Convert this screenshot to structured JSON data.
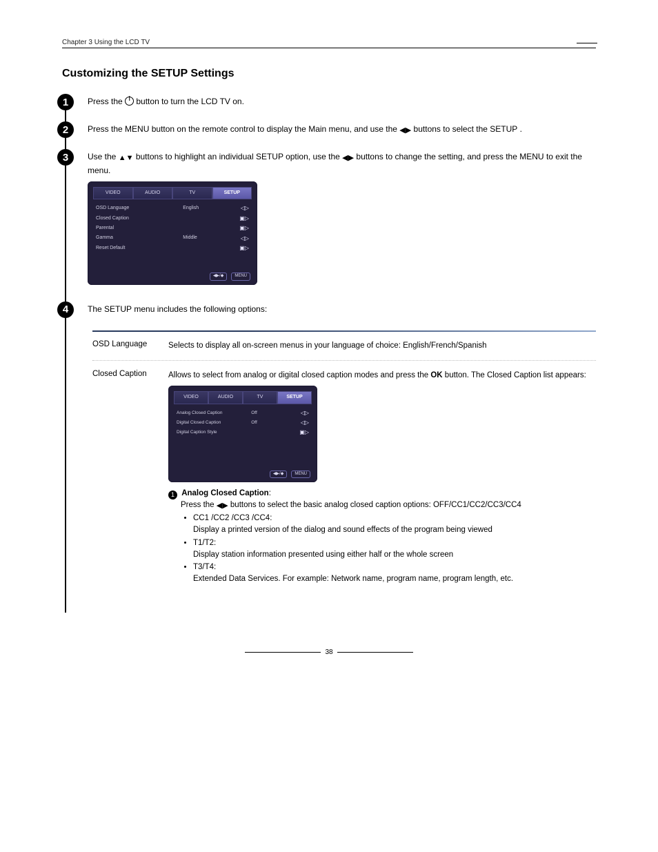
{
  "header": {
    "chapter": "Chapter 3  Using the LCD TV"
  },
  "title": "Customizing the SETUP Settings",
  "steps": {
    "s1": {
      "pre": "Press the ",
      "post": " button to turn the LCD TV on."
    },
    "s2": {
      "a": "Press the ",
      "menu": "MENU",
      "b": " button on the remote control to display the Main menu, and use the ",
      "c": " buttons to select the ",
      "setup": "SETUP",
      "d": "."
    },
    "s3": {
      "a": "Use the ",
      "b": " buttons to highlight an individual SETUP option, use the ",
      "c": " buttons to change the setting, and press the ",
      "menu": "MENU",
      "d": " to exit the menu."
    },
    "s4": {
      "a": "The ",
      "setup": "SETUP",
      "b": " menu includes the following options:"
    }
  },
  "osd1": {
    "tabs": [
      "VIDEO",
      "AUDIO",
      "TV",
      "SETUP"
    ],
    "rows": [
      {
        "lbl": "OSD Language",
        "val": "English",
        "ico": "◁▷"
      },
      {
        "lbl": "Closed Caption",
        "val": "",
        "ico": "▣▷"
      },
      {
        "lbl": "Parental",
        "val": "",
        "ico": "▣▷"
      },
      {
        "lbl": "Gamma",
        "val": "Middle",
        "ico": "◁▷"
      },
      {
        "lbl": "Reset Default",
        "val": "",
        "ico": "▣▷"
      }
    ],
    "foot": [
      "◀▶/◆",
      "MENU"
    ]
  },
  "osd2": {
    "tabs": [
      "VIDEO",
      "AUDIO",
      "TV",
      "SETUP"
    ],
    "rows": [
      {
        "lbl": "Analog Closed Caption",
        "val": "Off",
        "ico": "◁▷"
      },
      {
        "lbl": "Digital Closed Caption",
        "val": "Off",
        "ico": "◁▷"
      },
      {
        "lbl": "Digital Caption Style",
        "val": "",
        "ico": "▣▷"
      }
    ],
    "foot": [
      "◀▶/◆",
      "MENU"
    ]
  },
  "table": {
    "row1": {
      "label": "OSD Language",
      "desc": "Selects to display all on-screen menus in your language of choice: English/French/Spanish"
    },
    "row2": {
      "label": "Closed Caption",
      "intro_a": "Allows to select from analog or digital closed caption modes and press the ",
      "ok": "OK",
      "intro_b": " button. The Closed Caption list appears:",
      "acc_title": "Analog Closed Caption",
      "acc_a": "Press the ",
      "acc_b": " buttons to select the basic analog closed caption options: OFF/CC1/CC2/CC3/CC4",
      "li1a": "CC1 /CC2 /CC3 /CC4:",
      "li1b": "Display a printed version of the dialog and sound effects of the program being viewed",
      "li2a": "T1/T2:",
      "li2b": "Display station information presented using either half or the whole screen",
      "li3a": "T3/T4:",
      "li3b": "Extended Data Services. For example: Network name, program name, program length, etc."
    }
  },
  "pagenum": "38"
}
